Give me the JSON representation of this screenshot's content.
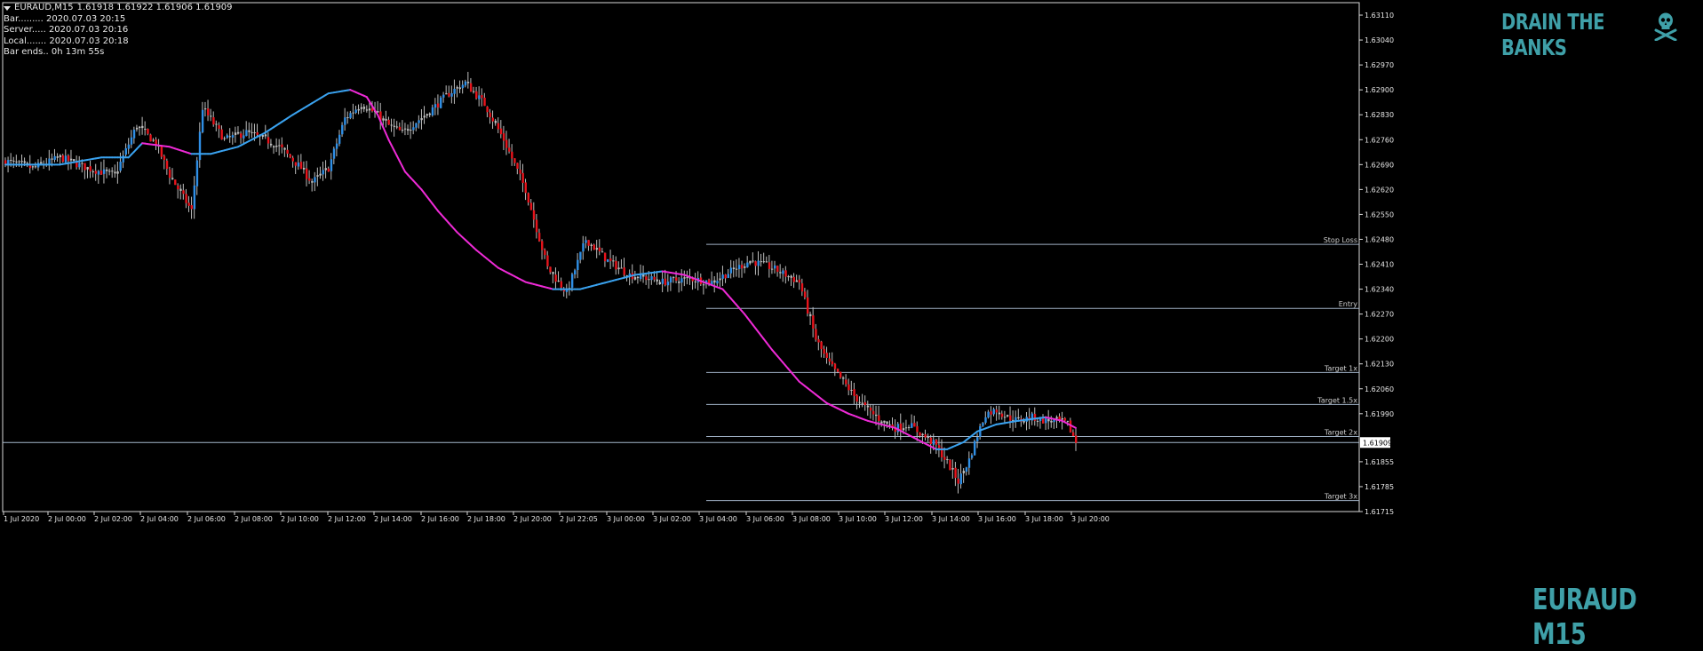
{
  "info": {
    "symbol": "EURAUD,M15",
    "ohlc": "1.61918 1.61922 1.61906 1.61909",
    "bar_label": "Bar......... 2020.07.03 20:15",
    "server_label": "Server..... 2020.07.03 20:16",
    "local_label": "Local....... 2020.07.03 20:18",
    "bar_ends_label": "Bar ends.. 0h 13m 55s"
  },
  "brand": "DRAIN THE BANKS",
  "symbol_watermark": "EURAUD M15",
  "colors": {
    "background": "#000000",
    "bull": "#2f8fe6",
    "bear": "#e8141c",
    "doji": "#bdbdbd",
    "ma_down": "#ee2ad6",
    "ma_up": "#3aa2ef",
    "level_line": "#9fb0c4",
    "text": "#e6e6e6",
    "watermark": "#3fa0a8"
  },
  "chart_data": {
    "type": "candlestick",
    "title": "EURAUD,M15",
    "bid": 1.61909,
    "ylim": [
      1.61715,
      1.63145
    ],
    "y_ticks": [
      "1.63110",
      "1.63040",
      "1.62970",
      "1.62900",
      "1.62830",
      "1.62760",
      "1.62690",
      "1.62620",
      "1.62550",
      "1.62480",
      "1.62410",
      "1.62340",
      "1.62270",
      "1.62200",
      "1.62130",
      "1.62060",
      "1.61990",
      "1.61855",
      "1.61785",
      "1.61715"
    ],
    "x_ticks": [
      "1 Jul 2020",
      "2 Jul 00:00",
      "2 Jul 02:00",
      "2 Jul 04:00",
      "2 Jul 06:00",
      "2 Jul 08:00",
      "2 Jul 10:00",
      "2 Jul 12:00",
      "2 Jul 14:00",
      "2 Jul 16:00",
      "2 Jul 18:00",
      "2 Jul 20:00",
      "2 Jul 22:05",
      "3 Jul 00:00",
      "3 Jul 02:00",
      "3 Jul 04:00",
      "3 Jul 06:00",
      "3 Jul 08:00",
      "3 Jul 10:00",
      "3 Jul 12:00",
      "3 Jul 14:00",
      "3 Jul 16:00",
      "3 Jul 18:00",
      "3 Jul 20:00"
    ],
    "levels": [
      {
        "label": "Stop Loss",
        "price": 1.62466
      },
      {
        "label": "Entry",
        "price": 1.62286
      },
      {
        "label": "Target 1x",
        "price": 1.62106
      },
      {
        "label": "Target 1.5x",
        "price": 1.62016
      },
      {
        "label": "Target 2x",
        "price": 1.61926
      },
      {
        "label": "Target 3x",
        "price": 1.61746
      }
    ],
    "close_path": [
      [
        0,
        1.627
      ],
      [
        10,
        1.6268
      ],
      [
        20,
        1.6271
      ],
      [
        30,
        1.6268
      ],
      [
        40,
        1.6266
      ],
      [
        48,
        1.628
      ],
      [
        55,
        1.6275
      ],
      [
        60,
        1.6266
      ],
      [
        68,
        1.6256
      ],
      [
        72,
        1.6285
      ],
      [
        80,
        1.6276
      ],
      [
        88,
        1.6278
      ],
      [
        95,
        1.6276
      ],
      [
        100,
        1.6274
      ],
      [
        108,
        1.6268
      ],
      [
        112,
        1.6264
      ],
      [
        118,
        1.6268
      ],
      [
        124,
        1.6282
      ],
      [
        130,
        1.6286
      ],
      [
        136,
        1.6283
      ],
      [
        140,
        1.628
      ],
      [
        145,
        1.6278
      ],
      [
        155,
        1.6284
      ],
      [
        162,
        1.6289
      ],
      [
        168,
        1.6292
      ],
      [
        175,
        1.6286
      ],
      [
        182,
        1.6276
      ],
      [
        190,
        1.6262
      ],
      [
        198,
        1.624
      ],
      [
        205,
        1.6233
      ],
      [
        212,
        1.6248
      ],
      [
        220,
        1.6242
      ],
      [
        228,
        1.6238
      ],
      [
        235,
        1.6237
      ],
      [
        240,
        1.6236
      ],
      [
        250,
        1.6237
      ],
      [
        258,
        1.6236
      ],
      [
        265,
        1.6239
      ],
      [
        272,
        1.6242
      ],
      [
        280,
        1.624
      ],
      [
        285,
        1.6238
      ],
      [
        290,
        1.6236
      ],
      [
        293,
        1.6228
      ],
      [
        296,
        1.622
      ],
      [
        300,
        1.6214
      ],
      [
        305,
        1.6209
      ],
      [
        310,
        1.6204
      ],
      [
        315,
        1.62
      ],
      [
        320,
        1.6197
      ],
      [
        325,
        1.6195
      ],
      [
        330,
        1.6196
      ],
      [
        335,
        1.6193
      ],
      [
        340,
        1.619
      ],
      [
        345,
        1.6184
      ],
      [
        348,
        1.618
      ],
      [
        352,
        1.6186
      ],
      [
        355,
        1.6193
      ],
      [
        358,
        1.6199
      ],
      [
        362,
        1.62
      ],
      [
        366,
        1.6198
      ],
      [
        370,
        1.6197
      ],
      [
        375,
        1.6198
      ],
      [
        380,
        1.6197
      ],
      [
        385,
        1.6197
      ],
      [
        388,
        1.6196
      ],
      [
        391,
        1.6191
      ]
    ],
    "ma_path": [
      [
        0,
        1.6269
      ],
      [
        20,
        1.6269
      ],
      [
        35,
        1.6271
      ],
      [
        45,
        1.6271
      ],
      [
        50,
        1.6275
      ],
      [
        60,
        1.6274
      ],
      [
        68,
        1.6272
      ],
      [
        75,
        1.6272
      ],
      [
        85,
        1.6274
      ],
      [
        95,
        1.6278
      ],
      [
        105,
        1.6283
      ],
      [
        118,
        1.6289
      ],
      [
        126,
        1.629
      ],
      [
        132,
        1.6288
      ],
      [
        136,
        1.6283
      ],
      [
        140,
        1.6276
      ],
      [
        146,
        1.6267
      ],
      [
        152,
        1.6262
      ],
      [
        158,
        1.6256
      ],
      [
        165,
        1.625
      ],
      [
        172,
        1.6245
      ],
      [
        180,
        1.624
      ],
      [
        190,
        1.6236
      ],
      [
        200,
        1.6234
      ],
      [
        210,
        1.6234
      ],
      [
        220,
        1.6236
      ],
      [
        230,
        1.6238
      ],
      [
        240,
        1.6239
      ],
      [
        248,
        1.6238
      ],
      [
        255,
        1.6236
      ],
      [
        262,
        1.6234
      ],
      [
        270,
        1.6227
      ],
      [
        280,
        1.6217
      ],
      [
        290,
        1.6208
      ],
      [
        300,
        1.6202
      ],
      [
        308,
        1.6199
      ],
      [
        315,
        1.6197
      ],
      [
        320,
        1.6196
      ],
      [
        325,
        1.6195
      ],
      [
        330,
        1.6193
      ],
      [
        335,
        1.6191
      ],
      [
        340,
        1.6189
      ],
      [
        344,
        1.6189
      ],
      [
        350,
        1.6191
      ],
      [
        355,
        1.6194
      ],
      [
        362,
        1.6196
      ],
      [
        370,
        1.6197
      ],
      [
        380,
        1.6198
      ],
      [
        386,
        1.6197
      ],
      [
        391,
        1.6195
      ]
    ]
  }
}
